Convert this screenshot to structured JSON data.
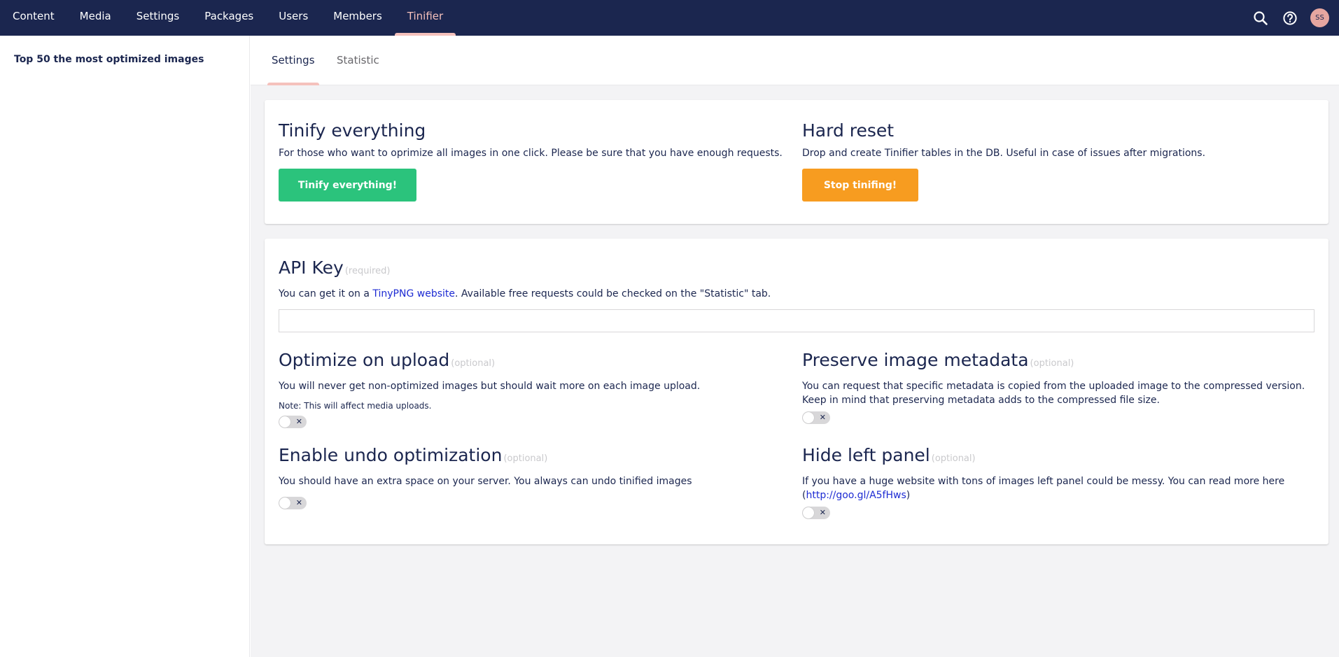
{
  "topnav": {
    "items": [
      {
        "label": "Content"
      },
      {
        "label": "Media"
      },
      {
        "label": "Settings"
      },
      {
        "label": "Packages"
      },
      {
        "label": "Users"
      },
      {
        "label": "Members"
      },
      {
        "label": "Tinifier",
        "active": true
      }
    ],
    "avatar_initials": "SS",
    "icons": [
      "search-icon",
      "help-icon"
    ]
  },
  "sidebar": {
    "items": [
      {
        "label": "Top 50 the most optimized images"
      }
    ]
  },
  "tabs": [
    {
      "label": "Settings",
      "active": true
    },
    {
      "label": "Statistic",
      "active": false
    }
  ],
  "actions": {
    "tinify": {
      "title": "Tinify everything",
      "description": "For those who want to oprimize all images in one click. Please be sure that you have enough requests.",
      "button_label": "Tinify everything!"
    },
    "reset": {
      "title": "Hard reset",
      "description": "Drop and create Tinifier tables in the DB. Useful in case of issues after migrations.",
      "button_label": "Stop tinifing!"
    }
  },
  "settings": {
    "api_key": {
      "title": "API Key",
      "tag": "(required)",
      "desc_before": "You can get it on a ",
      "link_text": "TinyPNG website",
      "desc_after": ". Available free requests could be checked on the \"Statistic\" tab.",
      "value": ""
    },
    "optimize_upload": {
      "title": "Optimize on upload",
      "tag": "(optional)",
      "description": "You will never get non-optimized images but should wait more on each image upload.",
      "note": "Note: This will affect media uploads.",
      "enabled": false
    },
    "preserve_metadata": {
      "title": "Preserve image metadata",
      "tag": "(optional)",
      "description": "You can request that specific metadata is copied from the uploaded image to the compressed version. Keep in mind that preserving metadata adds to the compressed file size.",
      "enabled": false
    },
    "undo": {
      "title": "Enable undo optimization",
      "tag": "(optional)",
      "description": "You should have an extra space on your server. You always can undo tinified images",
      "enabled": false
    },
    "hide_panel": {
      "title": "Hide left panel",
      "tag": "(optional)",
      "desc_before": "If you have a huge website with tons of images left panel could be messy. You can read more here (",
      "link_text": "http://goo.gl/A5fHws",
      "desc_after": ")",
      "enabled": false
    }
  },
  "colors": {
    "header_bg": "#1b264f",
    "accent_pink": "#f5c1bc",
    "green": "#2bc37c",
    "orange": "#f79c20",
    "link": "#1d2bd3"
  },
  "toggle_off_glyph": "✕"
}
